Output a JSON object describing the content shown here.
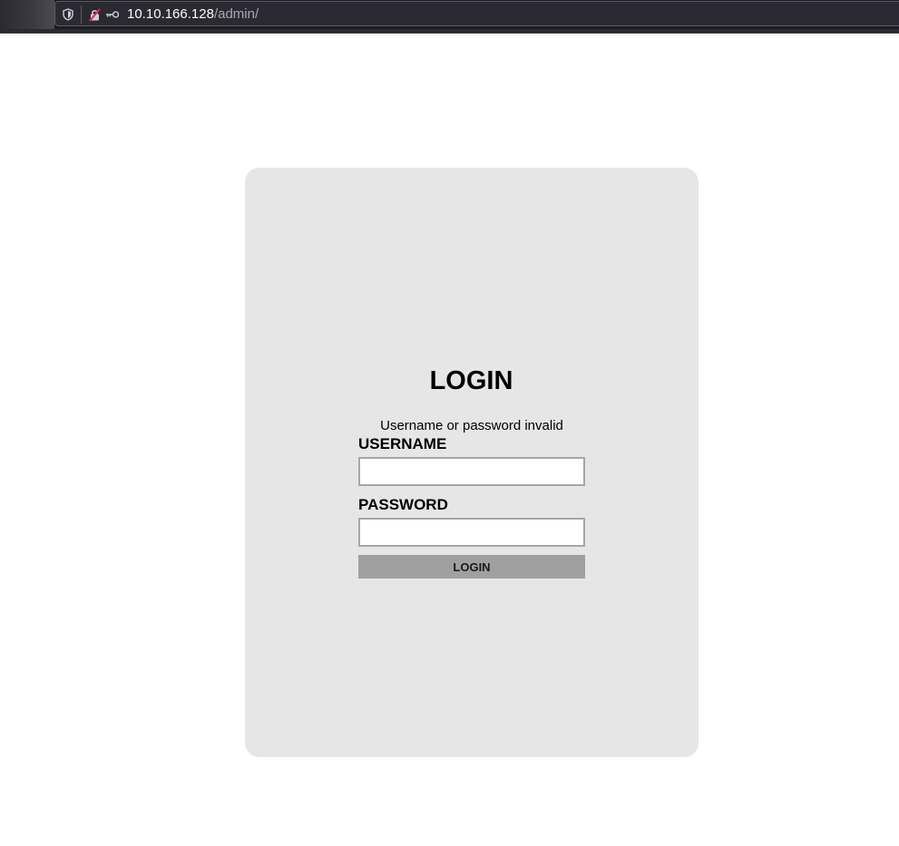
{
  "browser": {
    "url_host": "10.10.166.128",
    "url_path": "/admin/",
    "icons": [
      "shield-icon",
      "insecure-lock-icon",
      "key-icon"
    ]
  },
  "login": {
    "title": "LOGIN",
    "error_message": "Username or password invalid",
    "username_label": "USERNAME",
    "username_value": "",
    "password_label": "PASSWORD",
    "password_value": "",
    "button_label": "LOGIN"
  },
  "colors": {
    "card_background": "#e6e6e6",
    "button_background": "#a0a0a0",
    "toolbar_background": "#1c1b22"
  }
}
